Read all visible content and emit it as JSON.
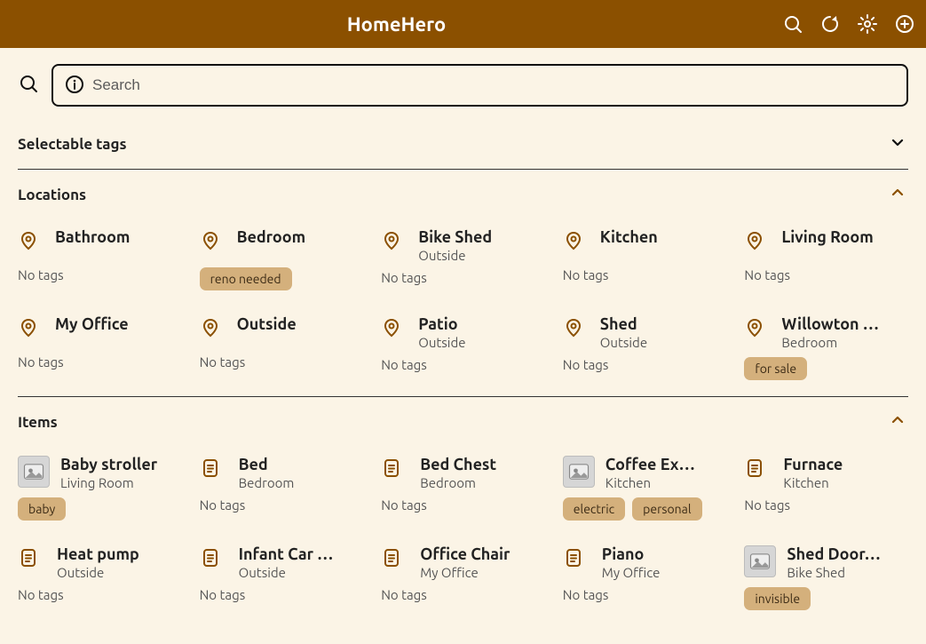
{
  "header": {
    "title": "HomeHero"
  },
  "search": {
    "placeholder": "Search"
  },
  "sections": {
    "selectable_tags": {
      "label": "Selectable tags",
      "expanded": false
    },
    "locations": {
      "label": "Locations",
      "expanded": true
    },
    "items": {
      "label": "Items",
      "expanded": true
    }
  },
  "no_tags_text": "No tags",
  "locations": [
    {
      "name": "Bathroom",
      "parent": null,
      "tags": []
    },
    {
      "name": "Bedroom",
      "parent": null,
      "tags": [
        "reno needed"
      ]
    },
    {
      "name": "Bike Shed",
      "parent": "Outside",
      "tags": []
    },
    {
      "name": "Kitchen",
      "parent": null,
      "tags": []
    },
    {
      "name": "Living Room",
      "parent": null,
      "tags": []
    },
    {
      "name": "My Office",
      "parent": null,
      "tags": []
    },
    {
      "name": "Outside",
      "parent": null,
      "tags": []
    },
    {
      "name": "Patio",
      "parent": "Outside",
      "tags": []
    },
    {
      "name": "Shed",
      "parent": "Outside",
      "tags": []
    },
    {
      "name": "Willowton …",
      "parent": "Bedroom",
      "tags": [
        "for sale"
      ]
    }
  ],
  "items": [
    {
      "name": "Baby stroller",
      "location": "Living Room",
      "tags": [
        "baby"
      ],
      "thumb": "photo"
    },
    {
      "name": "Bed",
      "location": "Bedroom",
      "tags": [],
      "thumb": "doc"
    },
    {
      "name": "Bed Chest",
      "location": "Bedroom",
      "tags": [],
      "thumb": "doc"
    },
    {
      "name": "Coffee Ex…",
      "location": "Kitchen",
      "tags": [
        "electric",
        "personal"
      ],
      "thumb": "photo"
    },
    {
      "name": "Furnace",
      "location": "Kitchen",
      "tags": [],
      "thumb": "doc"
    },
    {
      "name": "Heat pump",
      "location": "Outside",
      "tags": [],
      "thumb": "doc"
    },
    {
      "name": "Infant Car …",
      "location": "Outside",
      "tags": [],
      "thumb": "doc"
    },
    {
      "name": "Office Chair",
      "location": "My Office",
      "tags": [],
      "thumb": "doc"
    },
    {
      "name": "Piano",
      "location": "My Office",
      "tags": [],
      "thumb": "doc"
    },
    {
      "name": "Shed Door…",
      "location": "Bike Shed",
      "tags": [
        "invisible"
      ],
      "thumb": "photo"
    }
  ]
}
